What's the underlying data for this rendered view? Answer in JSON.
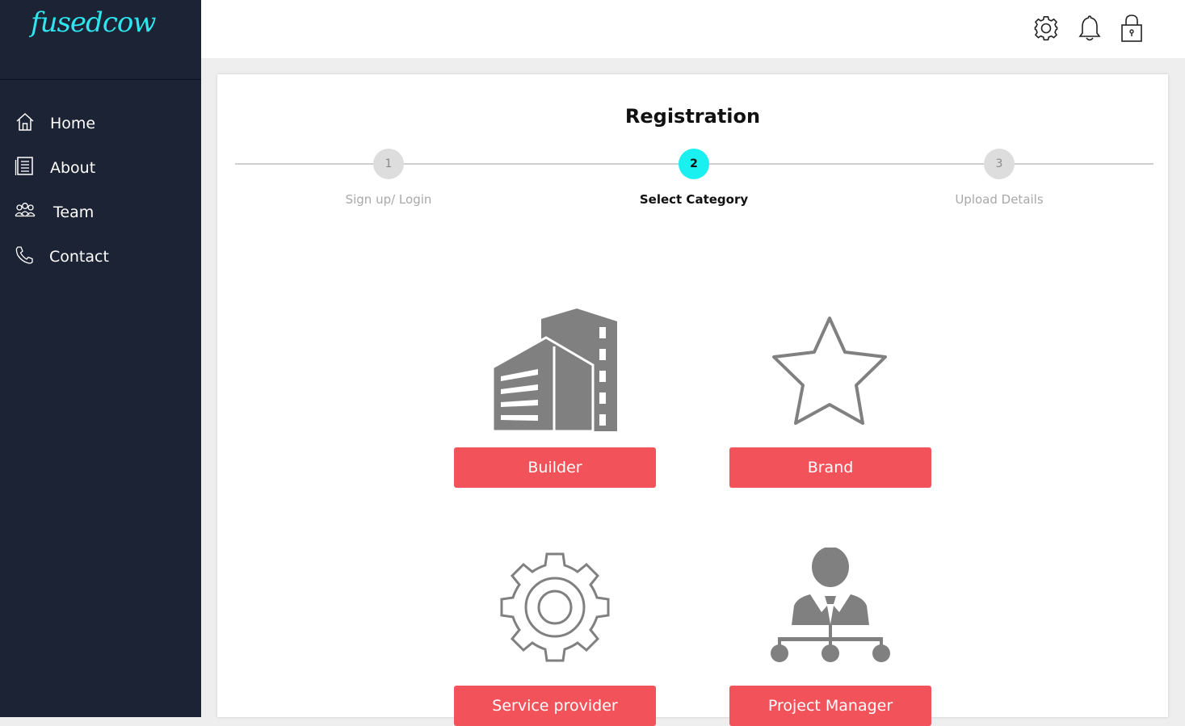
{
  "brand": {
    "name": "fusedcow",
    "accent": "#2de6ef"
  },
  "sidebar": {
    "items": [
      {
        "label": "Home",
        "icon": "home-icon"
      },
      {
        "label": "About",
        "icon": "document-icon"
      },
      {
        "label": "Team",
        "icon": "team-icon"
      },
      {
        "label": "Contact",
        "icon": "phone-icon"
      }
    ]
  },
  "topbar": {
    "icons": [
      "gear-icon",
      "bell-icon",
      "lock-icon"
    ]
  },
  "registration": {
    "title": "Registration",
    "steps": [
      {
        "number": "1",
        "label": "Sign up/ Login",
        "state": "inactive"
      },
      {
        "number": "2",
        "label": "Select Category",
        "state": "active"
      },
      {
        "number": "3",
        "label": "Upload Details",
        "state": "inactive"
      }
    ],
    "active_color": "#1af0f0"
  },
  "categories": [
    {
      "label": "Builder",
      "icon": "building-icon"
    },
    {
      "label": "Brand",
      "icon": "star-icon"
    },
    {
      "label": "Service provider",
      "icon": "gear-icon"
    },
    {
      "label": "Project Manager",
      "icon": "org-person-icon"
    }
  ],
  "button_color": "#f2535a"
}
